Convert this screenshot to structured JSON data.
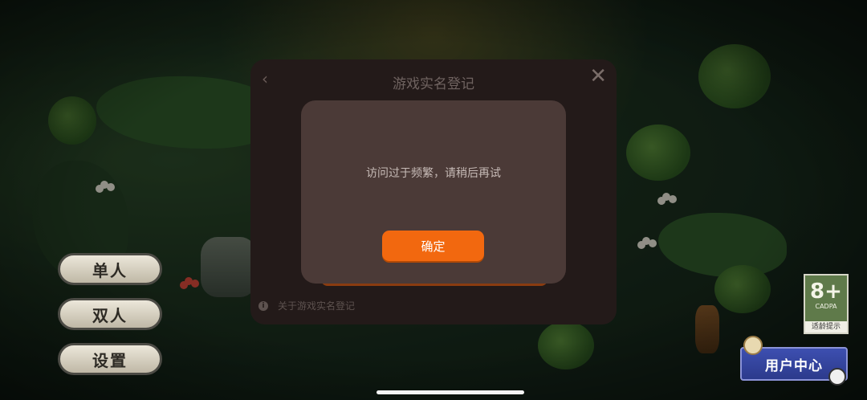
{
  "game_menu": {
    "single_label": "单人",
    "double_label": "双人",
    "settings_label": "设置"
  },
  "age_rating": {
    "age": "8+",
    "org": "CADPA",
    "tip": "适龄提示"
  },
  "user_center": {
    "label": "用户中心"
  },
  "registration_dialog": {
    "title": "游戏实名登记",
    "back_icon": "chevron-left-icon",
    "close_icon": "close-icon",
    "about_label": "关于游戏实名登记",
    "info_icon": "info-icon"
  },
  "alert": {
    "message": "访问过于频繁，请稍后再试",
    "confirm_label": "确定"
  },
  "colors": {
    "accent": "#f2680f",
    "dialog_bg": "#231a19",
    "alert_bg": "#4b3a37",
    "user_center_bg": "#3d4fb0"
  }
}
